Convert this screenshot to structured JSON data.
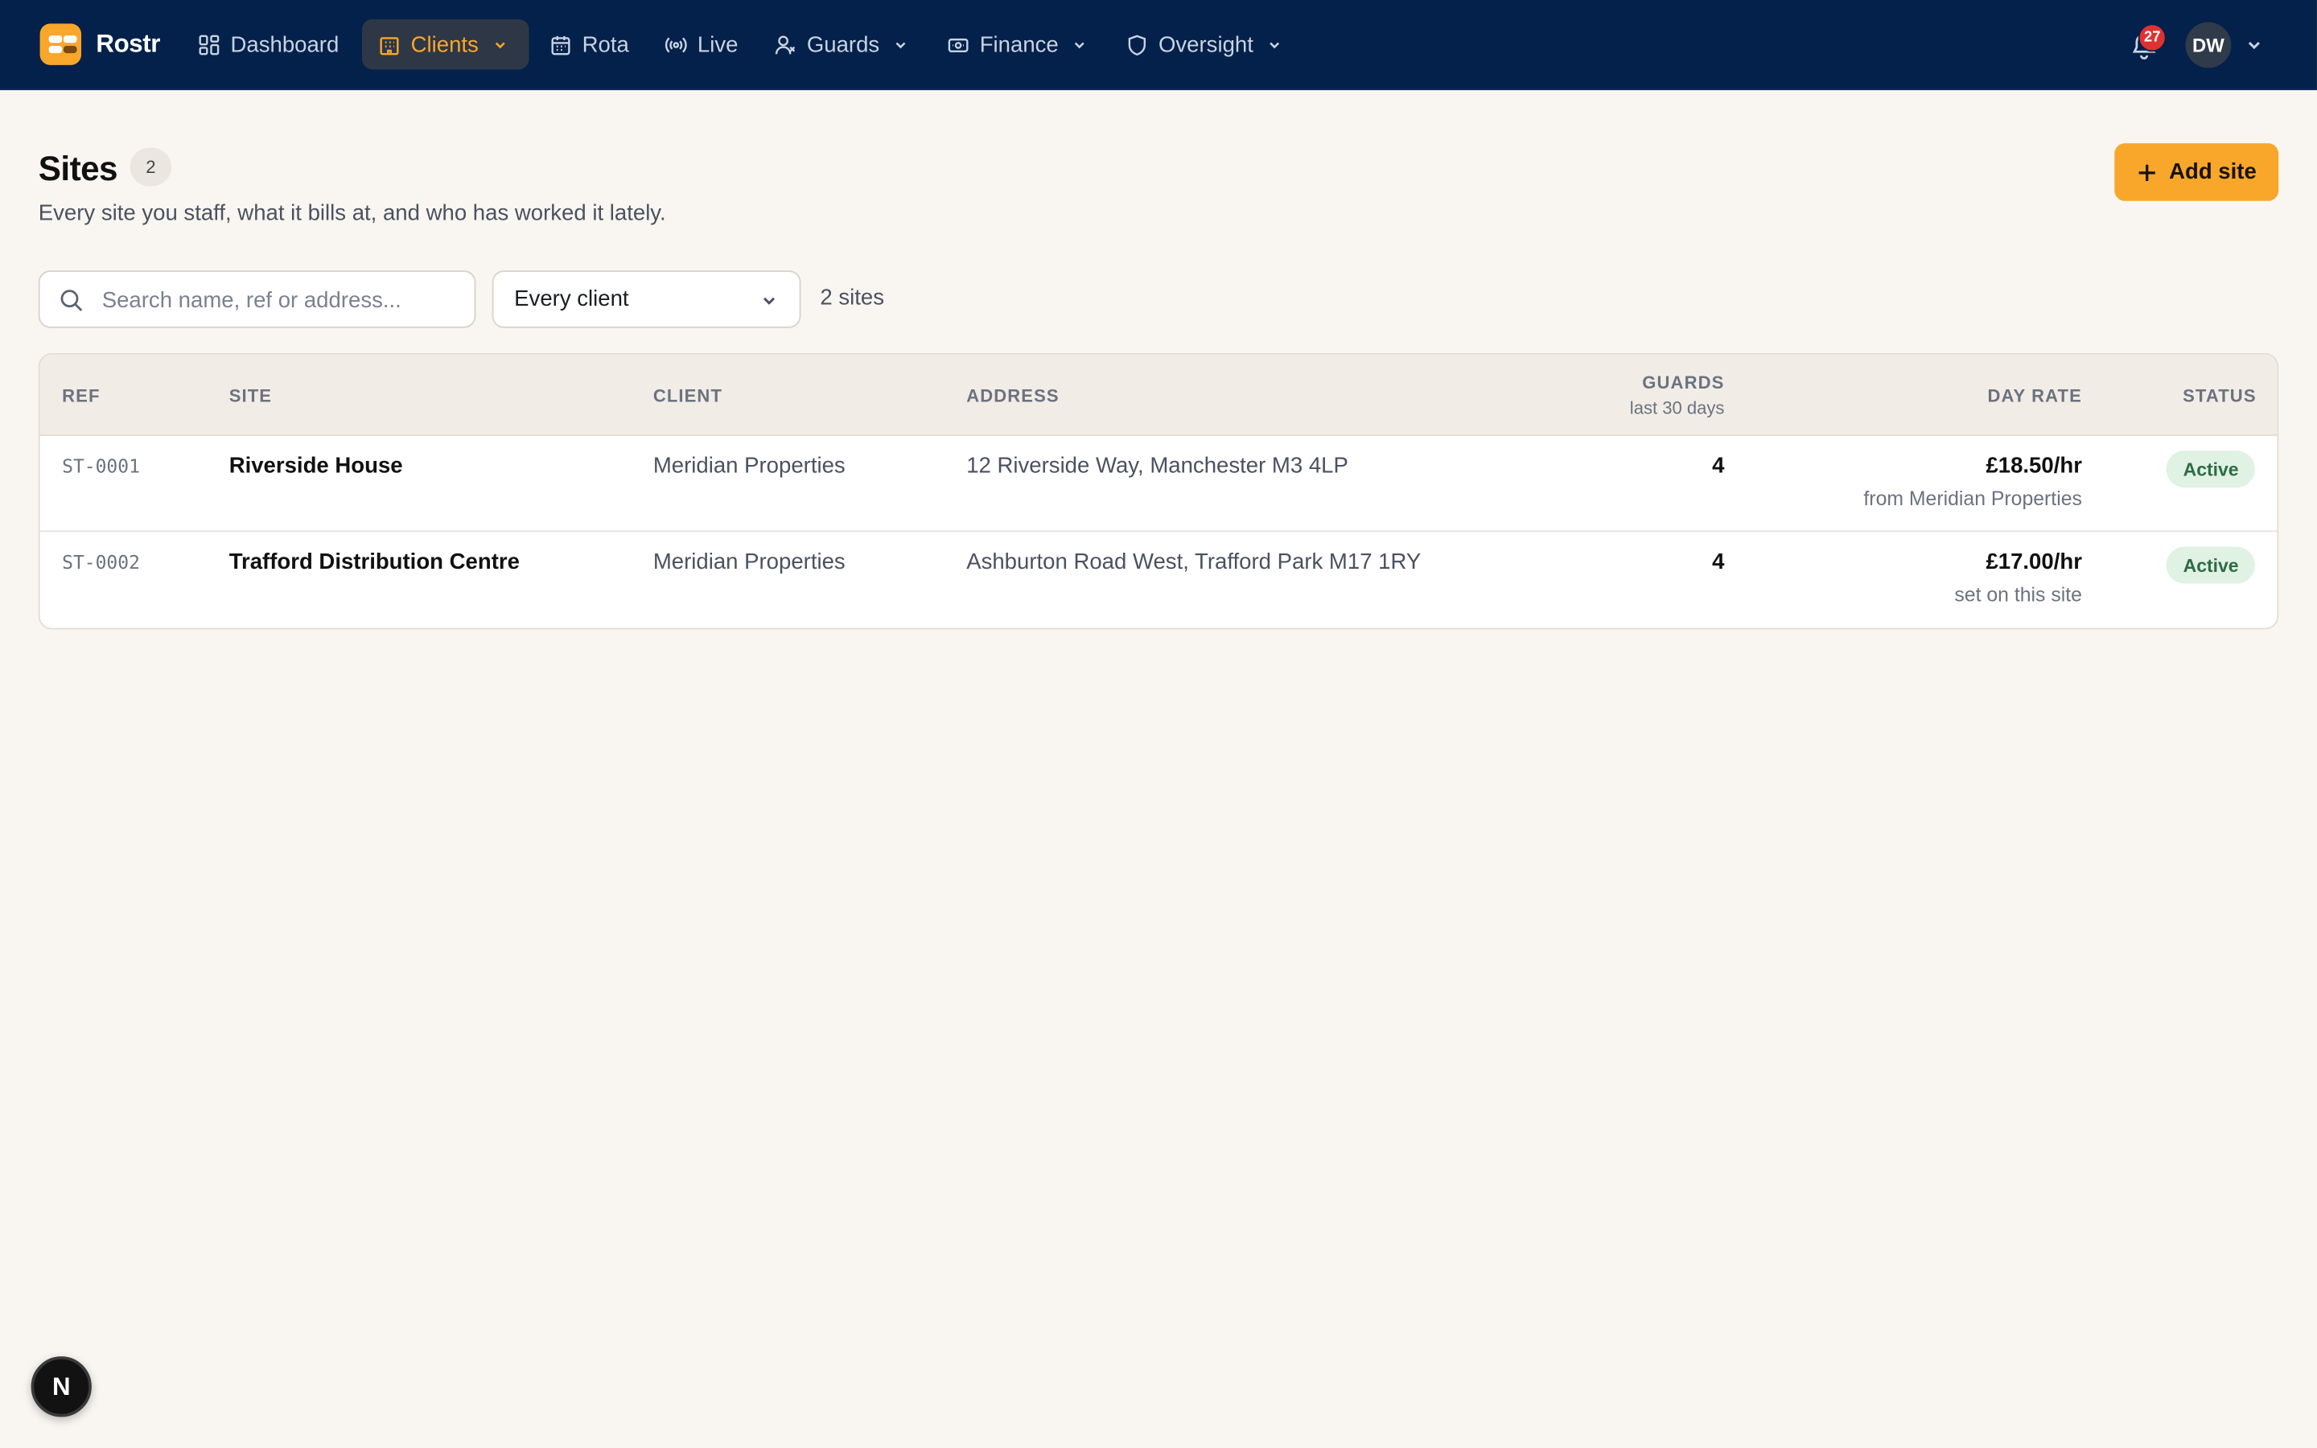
{
  "app": {
    "brand": "Rostr"
  },
  "nav": [
    {
      "label": "Dashboard",
      "icon": "dashboard-icon"
    },
    {
      "label": "Clients",
      "icon": "building-icon",
      "active": true
    },
    {
      "label": "Rota",
      "icon": "calendar-icon"
    },
    {
      "label": "Live",
      "icon": "broadcast-icon"
    },
    {
      "label": "Guards",
      "icon": "user-icon"
    },
    {
      "label": "Finance",
      "icon": "banknote-icon"
    },
    {
      "label": "Oversight",
      "icon": "shield-icon"
    }
  ],
  "header_right": {
    "notification_count": "27",
    "avatar_initials": "DW"
  },
  "page": {
    "title": "Sites",
    "count": "2",
    "subtitle": "Every site you staff, what it bills at, and who has worked it lately.",
    "add_button": "Add site"
  },
  "filters": {
    "search_placeholder": "Search name, ref or address...",
    "client_select": "Every client",
    "result_count": "2 sites"
  },
  "table": {
    "headers": {
      "ref": "REF",
      "site": "SITE",
      "client": "CLIENT",
      "address": "ADDRESS",
      "guards": "GUARDS",
      "guards_sub": "last 30 days",
      "day_rate": "DAY RATE",
      "status": "STATUS"
    },
    "rows": [
      {
        "ref": "ST-0001",
        "site": "Riverside House",
        "client": "Meridian Properties",
        "address": "12 Riverside Way, Manchester M3 4LP",
        "guards": "4",
        "rate": "£18.50/hr",
        "rate_source": "from Meridian Properties",
        "status": "Active"
      },
      {
        "ref": "ST-0002",
        "site": "Trafford Distribution Centre",
        "client": "Meridian Properties",
        "address": "Ashburton Road West, Trafford Park M17 1RY",
        "guards": "4",
        "rate": "£17.00/hr",
        "rate_source": "set on this site",
        "status": "Active"
      }
    ]
  },
  "dev_badge": "N",
  "colors": {
    "navbar": "#03214a",
    "accent": "#f9a72a",
    "background": "#f9f6f1",
    "status_active": "#dff2e4"
  }
}
